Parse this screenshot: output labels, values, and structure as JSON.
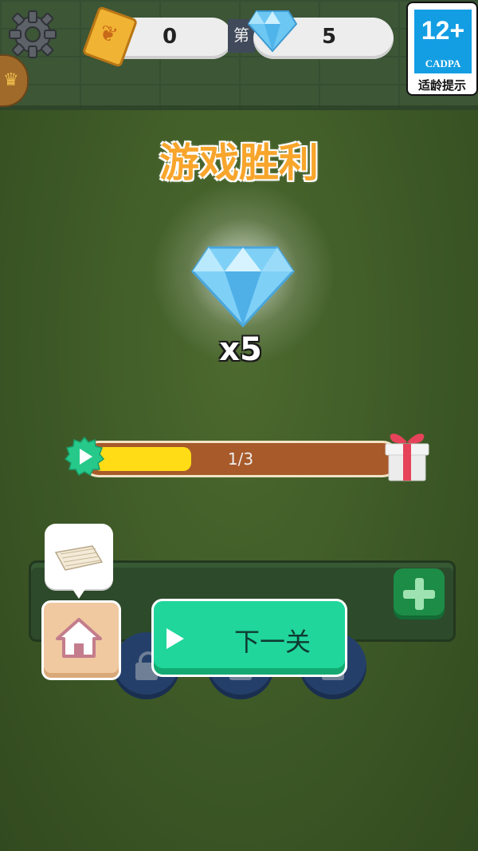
{
  "hud": {
    "cards_count": "0",
    "gems_count": "5",
    "level_prefix": "第"
  },
  "age_rating": {
    "age": "12+",
    "org": "CADPA",
    "tip": "适龄提示"
  },
  "result": {
    "title": "游戏胜利",
    "reward_icon": "diamond-icon",
    "reward_quantity": "x5"
  },
  "progress": {
    "label": "1/3",
    "fraction": 0.333
  },
  "actions": {
    "next_label": "下一关",
    "home_icon": "house-icon",
    "add_icon": "plus-icon"
  },
  "colors": {
    "title": "#f8a52c",
    "next_button": "#20d69a",
    "progress_fill": "#ffdc16",
    "diamond": "#6cc7f3"
  }
}
